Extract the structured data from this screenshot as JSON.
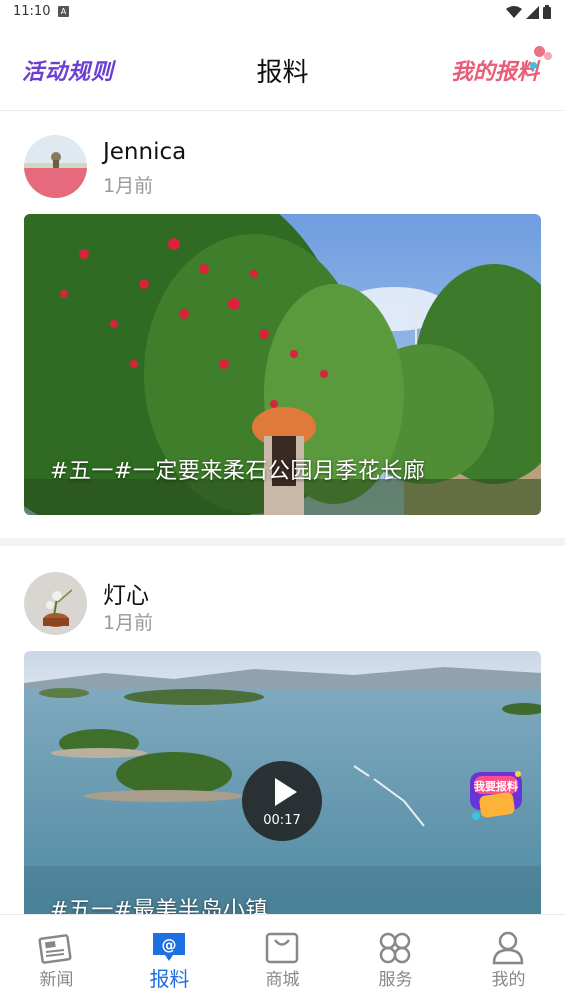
{
  "status_bar": {
    "time": "11:10",
    "notif_glyph": "A"
  },
  "header": {
    "rules_label": "活动规则",
    "title": "报料",
    "my_reports_label": "我的报料"
  },
  "posts": [
    {
      "user": "Jennica",
      "time": "1月前",
      "caption": "#五一#一定要来柔石公园月季花长廊",
      "type": "image"
    },
    {
      "user": "灯心",
      "time": "1月前",
      "caption": "#五一#最美半岛小镇",
      "type": "video",
      "duration": "00:17"
    }
  ],
  "float_badge": {
    "label": "我要报料"
  },
  "tabbar": {
    "items": [
      {
        "label": "新闻",
        "icon": "news-icon",
        "active": false
      },
      {
        "label": "报料",
        "icon": "report-icon",
        "active": true
      },
      {
        "label": "商城",
        "icon": "shop-bag-icon",
        "active": false
      },
      {
        "label": "服务",
        "icon": "services-grid-icon",
        "active": false
      },
      {
        "label": "我的",
        "icon": "user-icon",
        "active": false
      }
    ]
  },
  "colors": {
    "accent": "#1e6fe0",
    "rules_purple": "#6b3fd4",
    "mine_pink": "#e85d7a"
  }
}
